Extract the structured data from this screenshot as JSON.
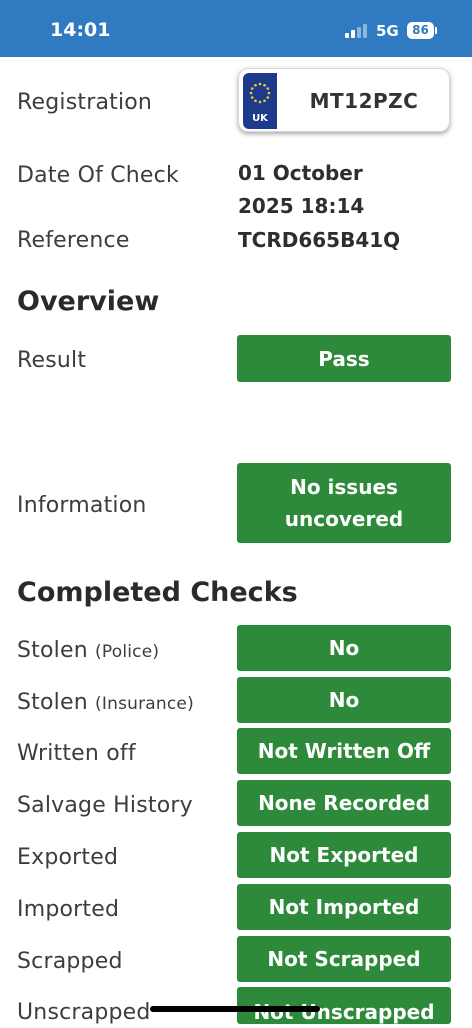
{
  "status_bar": {
    "time": "14:01",
    "network": "5G",
    "battery": "86"
  },
  "vehicle": {
    "registration_label": "Registration",
    "plate_country": "UK",
    "plate_number": "MT12PZC",
    "date_label": "Date Of Check",
    "date_line1": "01 October",
    "date_line2": "2025 18:14",
    "reference_label": "Reference",
    "reference_value": "TCRD665B41Q"
  },
  "overview": {
    "heading": "Overview",
    "result_label": "Result",
    "result_value": "Pass",
    "information_label": "Information",
    "information_line1": "No issues",
    "information_line2": "uncovered"
  },
  "checks": {
    "heading": "Completed Checks",
    "items": [
      {
        "label": "Stolen",
        "qualifier": "(Police)",
        "value": "No"
      },
      {
        "label": "Stolen",
        "qualifier": "(Insurance)",
        "value": "No"
      },
      {
        "label": "Written off",
        "qualifier": "",
        "value": "Not Written Off"
      },
      {
        "label": "Salvage History",
        "qualifier": "",
        "value": "None Recorded"
      },
      {
        "label": "Exported",
        "qualifier": "",
        "value": "Not Exported"
      },
      {
        "label": "Imported",
        "qualifier": "",
        "value": "Not Imported"
      },
      {
        "label": "Scrapped",
        "qualifier": "",
        "value": "Not Scrapped"
      },
      {
        "label": "Unscrapped",
        "qualifier": "",
        "value": "Not Unscrapped"
      }
    ]
  },
  "colors": {
    "status_bar": "#2f7ac0",
    "pass_green": "#2d8a3a",
    "eu_blue": "#1d3a8c"
  }
}
